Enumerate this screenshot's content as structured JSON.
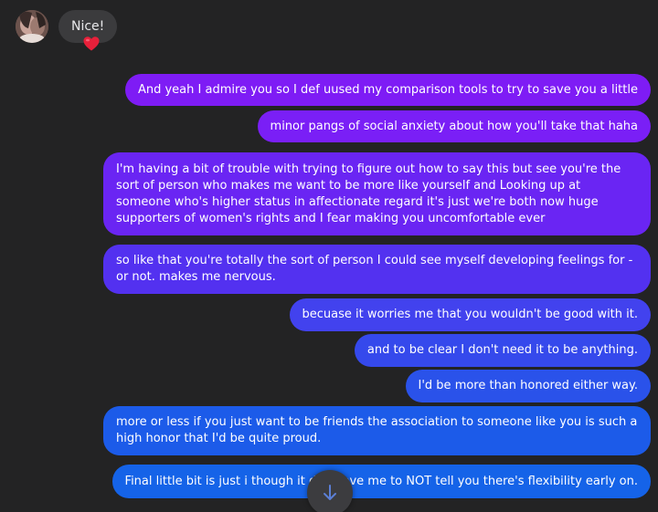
{
  "incoming": {
    "text": "Nice!",
    "reaction_icon": "heart-emoji"
  },
  "outgoing": [
    {
      "text": "And yeah I admire  you so I  def uused my comparison tools to try to save you a little",
      "color": "#7e1cf5"
    },
    {
      "text": "minor pangs of social anxiety   about how you'll take that haha",
      "color": "#7a1ff6"
    },
    {
      "text": "I'm having a bit of trouble with  trying to  figure out how to say this but see you're the sort of person who makes me want to be more like yourself and  Looking up at someone who's higher status  in affectionate regard it's just we're both now huge supporters of women's rights and I fear making you uncomfortable ever",
      "color": "#6a25f3"
    },
    {
      "text": "so like that you're totally the sort of person I could see myself developing feelings for -or not. makes me nervous.",
      "color": "#5331f0"
    },
    {
      "text": "becuase it worries me that you wouldn't be good with it.",
      "color": "#4242ee"
    },
    {
      "text": "and to be clear I don't need  it to be anything.",
      "color": "#3549ec"
    },
    {
      "text": "I'd be more than honored either way.",
      "color": "#2a52ea"
    },
    {
      "text": "more or less if you just want to be friends the association to someone like you is such a high honor  that I'd be quite proud.",
      "color": "#1c5be9"
    },
    {
      "text": "Final little bit is just i though it do        hoove me to NOT tell you there's flexibility   early on.",
      "color": "#1563e8"
    }
  ],
  "scroll_button_icon": "arrow-down-icon"
}
